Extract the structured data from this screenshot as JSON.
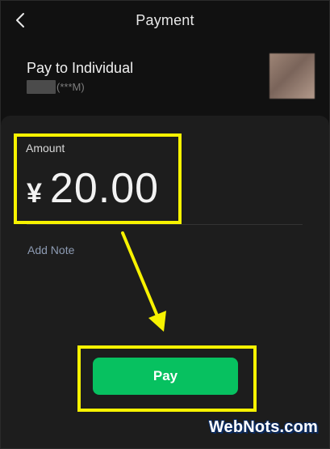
{
  "header": {
    "title": "Payment"
  },
  "payee": {
    "label": "Pay to Individual",
    "masked_id": "(***M)"
  },
  "amount": {
    "label": "Amount",
    "currency": "¥",
    "value": "20.00"
  },
  "note": {
    "label": "Add Note"
  },
  "actions": {
    "pay_label": "Pay"
  },
  "watermark": {
    "text": "WebNots.com"
  },
  "colors": {
    "background": "#111111",
    "sheet": "#1d1d1d",
    "accent_green": "#07c160",
    "highlight_yellow": "#f7f200",
    "note_link": "#8d9bb3"
  },
  "icons": {
    "back": "chevron-left-icon"
  }
}
